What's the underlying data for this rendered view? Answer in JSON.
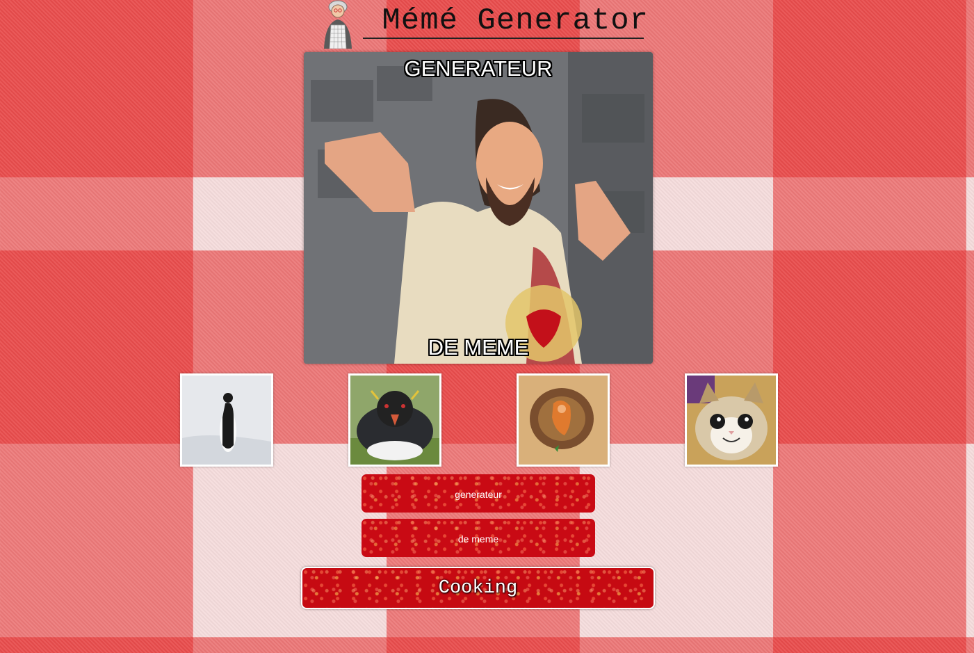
{
  "header": {
    "title": " Mémé Generator",
    "logo_icon": "grandma-chef-icon"
  },
  "meme": {
    "top_text": "GENERATEUR",
    "bottom_text": "DE MEME",
    "image": "buddy-christ-statue"
  },
  "thumbnails": [
    {
      "image": "penguin-snow"
    },
    {
      "image": "angry-penguin"
    },
    {
      "image": "explosion-crater"
    },
    {
      "image": "smiling-cat"
    }
  ],
  "inputs": {
    "top_placeholder": "generateur",
    "bottom_placeholder": "de meme"
  },
  "cook_button": {
    "label": "Cooking"
  },
  "colors": {
    "accent": "#c90a14",
    "tablecloth_red": "#e62828"
  }
}
